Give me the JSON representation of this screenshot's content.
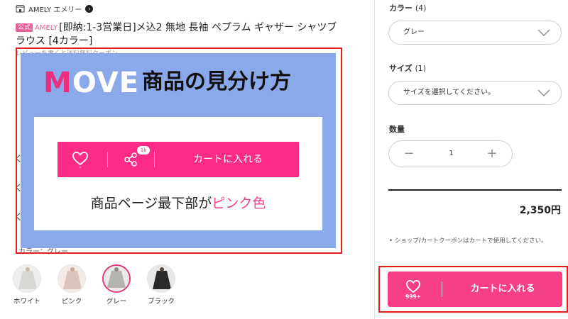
{
  "shop": {
    "name": "AMELY エメリー",
    "icon": "shop-icon",
    "arrow_icon": "chevron-right-icon"
  },
  "product": {
    "badge": "公式",
    "brand_tag": "AMELY",
    "title": "[即納:1-3営業日]メ込2 無地 長袖 ペプラム ギャザー シャツブラウス [4カラー]"
  },
  "obscured_peeks": {
    "line_under_title": "レビューを書くと送料無料クーポン",
    "color_row": "カラー：グレー",
    "side_chars": [
      "く",
      "く",
      "く"
    ]
  },
  "overlay": {
    "logo_heart": "M",
    "logo_rest": "OVE",
    "headline": "商品の見分け方",
    "share_badge": "1k",
    "demo_cart_label": "カートに入れる",
    "caption_prefix": "商品ページ最下部が",
    "caption_highlight": "ピンク色",
    "colors": {
      "panel": "#8aa9ea",
      "bar": "#fb2b86",
      "highlight": "#f1448e",
      "logo_heart": "#ec2f80"
    }
  },
  "swatches": [
    {
      "label": "ホワイト",
      "tone": "#d9d7d3",
      "selected": false
    },
    {
      "label": "ピンク",
      "tone": "#dcc3bd",
      "selected": false
    },
    {
      "label": "グレー",
      "tone": "#b5b3b0",
      "selected": true
    },
    {
      "label": "ブラック",
      "tone": "#2c2a29",
      "selected": false
    }
  ],
  "options": {
    "color": {
      "label": "カラー",
      "count": "(4)",
      "value": "グレー"
    },
    "size": {
      "label": "サイズ",
      "count": "(1)",
      "placeholder": "サイズを選択してください。"
    },
    "quantity": {
      "label": "数量",
      "value": "1",
      "minus": "−",
      "plus": "+"
    }
  },
  "price": "2,350円",
  "coupon_note": "• ショップ/カートクーポンはカートで使用してください。",
  "cart_button": {
    "favorite_count": "999+",
    "label": "カートに入れる",
    "color": "#f63f87"
  },
  "accent_colors": {
    "highlight_frame": "#e21f1f",
    "pink": "#e95f9a"
  }
}
